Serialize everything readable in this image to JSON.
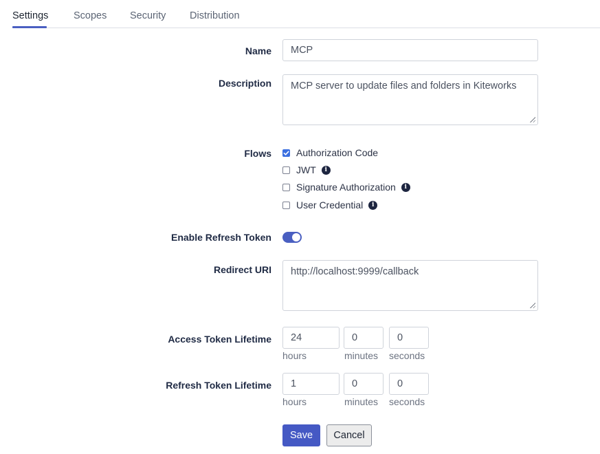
{
  "tabs": [
    {
      "label": "Settings",
      "active": true
    },
    {
      "label": "Scopes",
      "active": false
    },
    {
      "label": "Security",
      "active": false
    },
    {
      "label": "Distribution",
      "active": false
    }
  ],
  "accent_color": "#4a5fc1",
  "form": {
    "name": {
      "label": "Name",
      "value": "MCP"
    },
    "description": {
      "label": "Description",
      "value": "MCP server to update files and folders in Kiteworks"
    },
    "flows": {
      "label": "Flows",
      "options": [
        {
          "label": "Authorization Code",
          "checked": true,
          "info": false
        },
        {
          "label": "JWT",
          "checked": false,
          "info": true
        },
        {
          "label": "Signature Authorization",
          "checked": false,
          "info": true
        },
        {
          "label": "User Credential",
          "checked": false,
          "info": true
        }
      ]
    },
    "refresh_token": {
      "label": "Enable Refresh Token",
      "enabled": true
    },
    "redirect_uri": {
      "label": "Redirect URI",
      "value": "http://localhost:9999/callback"
    },
    "access_token_lifetime": {
      "label": "Access Token Lifetime",
      "hours": "24",
      "minutes": "0",
      "seconds": "0"
    },
    "refresh_token_lifetime": {
      "label": "Refresh Token Lifetime",
      "hours": "1",
      "minutes": "0",
      "seconds": "0"
    },
    "units": {
      "hours": "hours",
      "minutes": "minutes",
      "seconds": "seconds"
    }
  },
  "buttons": {
    "save": "Save",
    "cancel": "Cancel"
  },
  "icons": {
    "info": "info-circle-icon",
    "check": "checkmark-icon"
  }
}
